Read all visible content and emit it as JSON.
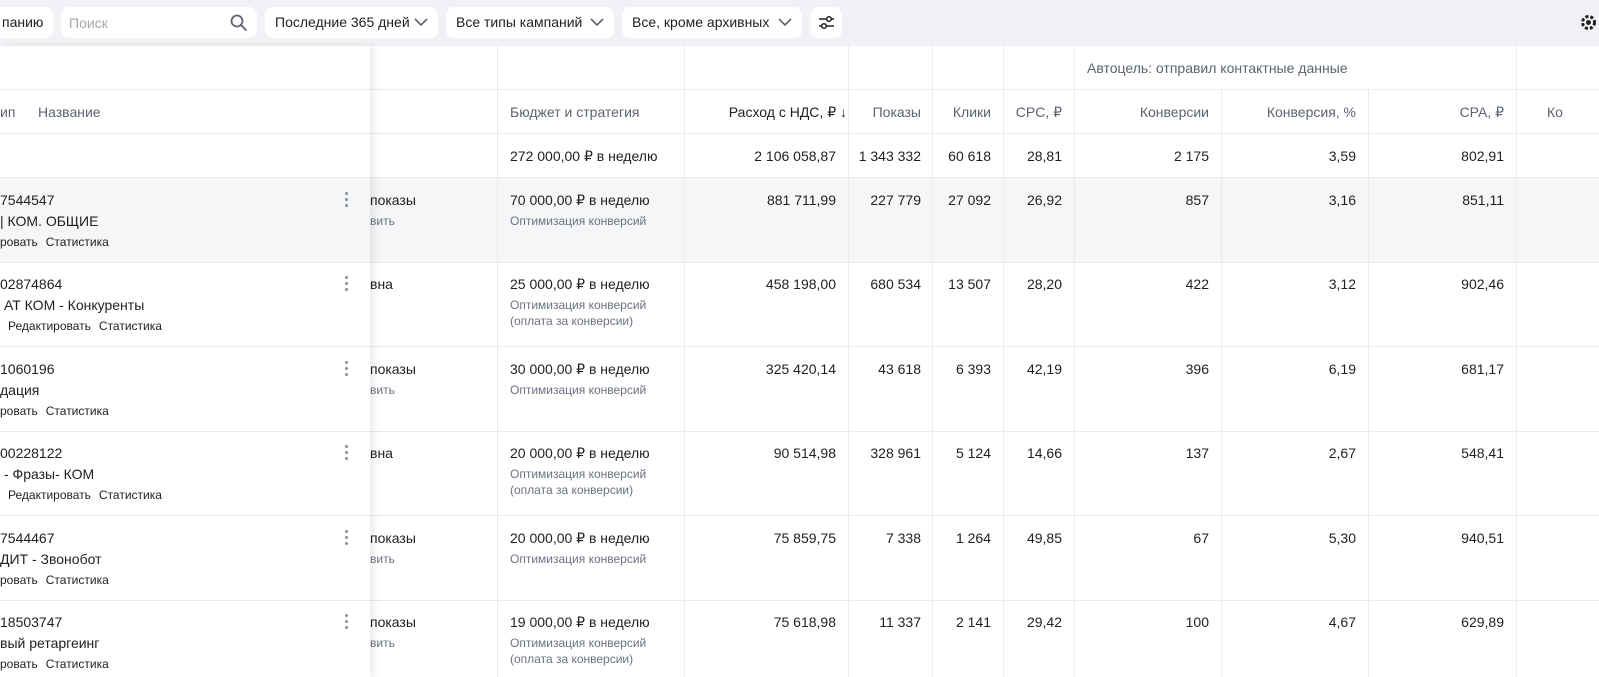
{
  "toolbar": {
    "create_label": "панию",
    "search_placeholder": "Поиск",
    "period": "Последние 365 дней",
    "types": "Все типы кампаний",
    "status": "Все, кроме архивных"
  },
  "header": {
    "group_goal": "Автоцель: отправил контактные данные",
    "col_type": "ип",
    "col_name": "Название",
    "col_budget": "Бюджет и стратегия",
    "col_cost": "Расход с НДС, ₽ ↓",
    "col_impr": "Показы",
    "col_clicks": "Клики",
    "col_cpc": "CPC, ₽",
    "col_conv": "Конверсии",
    "col_conv_rate": "Конверсия, %",
    "col_cpa": "CPA, ₽",
    "col_more": "Ко"
  },
  "totals": {
    "budget": "272 000,00 ₽ в неделю",
    "cost": "2 106 058,87",
    "impr": "1 343 332",
    "clicks": "60 618",
    "cpc": "28,81",
    "conv": "2 175",
    "conv_rate": "3,59",
    "cpa": "802,91"
  },
  "rows": [
    {
      "id": "7544547",
      "name": "| КОМ. ОБЩИЕ",
      "actions": [
        "ровать",
        "Статистика"
      ],
      "status": "показы",
      "status2": "вить",
      "budget": "70 000,00 ₽ в неделю",
      "strategy": "Оптимизация конверсий",
      "strategy2": "",
      "cost": "881 711,99",
      "impr": "227 779",
      "clicks": "27 092",
      "cpc": "26,92",
      "conv": "857",
      "conv_rate": "3,16",
      "cpa": "851,11"
    },
    {
      "id": "02874864",
      "name": "АТ КОМ - Конкуренты",
      "actions": [
        "Редактировать",
        "Статистика"
      ],
      "status": "вна",
      "status2": "",
      "budget": "25 000,00 ₽ в неделю",
      "strategy": "Оптимизация конверсий",
      "strategy2": "(оплата за конверсии)",
      "cost": "458 198,00",
      "impr": "680 534",
      "clicks": "13 507",
      "cpc": "28,20",
      "conv": "422",
      "conv_rate": "3,12",
      "cpa": "902,46"
    },
    {
      "id": "1060196",
      "name": "дация",
      "actions": [
        "ровать",
        "Статистика"
      ],
      "status": "показы",
      "status2": "вить",
      "budget": "30 000,00 ₽ в неделю",
      "strategy": "Оптимизация конверсий",
      "strategy2": "",
      "cost": "325 420,14",
      "impr": "43 618",
      "clicks": "6 393",
      "cpc": "42,19",
      "conv": "396",
      "conv_rate": "6,19",
      "cpa": "681,17"
    },
    {
      "id": "00228122",
      "name": "- Фразы- КОМ",
      "actions": [
        "Редактировать",
        "Статистика"
      ],
      "status": "вна",
      "status2": "",
      "budget": "20 000,00 ₽ в неделю",
      "strategy": "Оптимизация конверсий",
      "strategy2": "(оплата за конверсии)",
      "cost": "90 514,98",
      "impr": "328 961",
      "clicks": "5 124",
      "cpc": "14,66",
      "conv": "137",
      "conv_rate": "2,67",
      "cpa": "548,41"
    },
    {
      "id": "7544467",
      "name": "ДИТ - Звонобот",
      "actions": [
        "ровать",
        "Статистика"
      ],
      "status": "показы",
      "status2": "вить",
      "budget": "20 000,00 ₽ в неделю",
      "strategy": "Оптимизация конверсий",
      "strategy2": "",
      "cost": "75 859,75",
      "impr": "7 338",
      "clicks": "1 264",
      "cpc": "49,85",
      "conv": "67",
      "conv_rate": "5,30",
      "cpa": "940,51"
    },
    {
      "id": "18503747",
      "name": "вый ретаргеинг",
      "actions": [
        "ровать",
        "Статистика"
      ],
      "status": "показы",
      "status2": "вить",
      "budget": "19 000,00 ₽ в неделю",
      "strategy": "Оптимизация конверсий",
      "strategy2": "(оплата за конверсии)",
      "cost": "75 618,98",
      "impr": "11 337",
      "clicks": "2 141",
      "cpc": "29,42",
      "conv": "100",
      "conv_rate": "4,67",
      "cpa": "629,89"
    }
  ],
  "colors": {
    "toolbar_bg": "#f1f2f5",
    "highlight_row": "#f5f6f8",
    "header_text": "#5b6371"
  },
  "icons": [
    "search-icon",
    "chevron-down-icon",
    "filter-sliders-icon",
    "gear-icon",
    "more-vertical-icon"
  ]
}
